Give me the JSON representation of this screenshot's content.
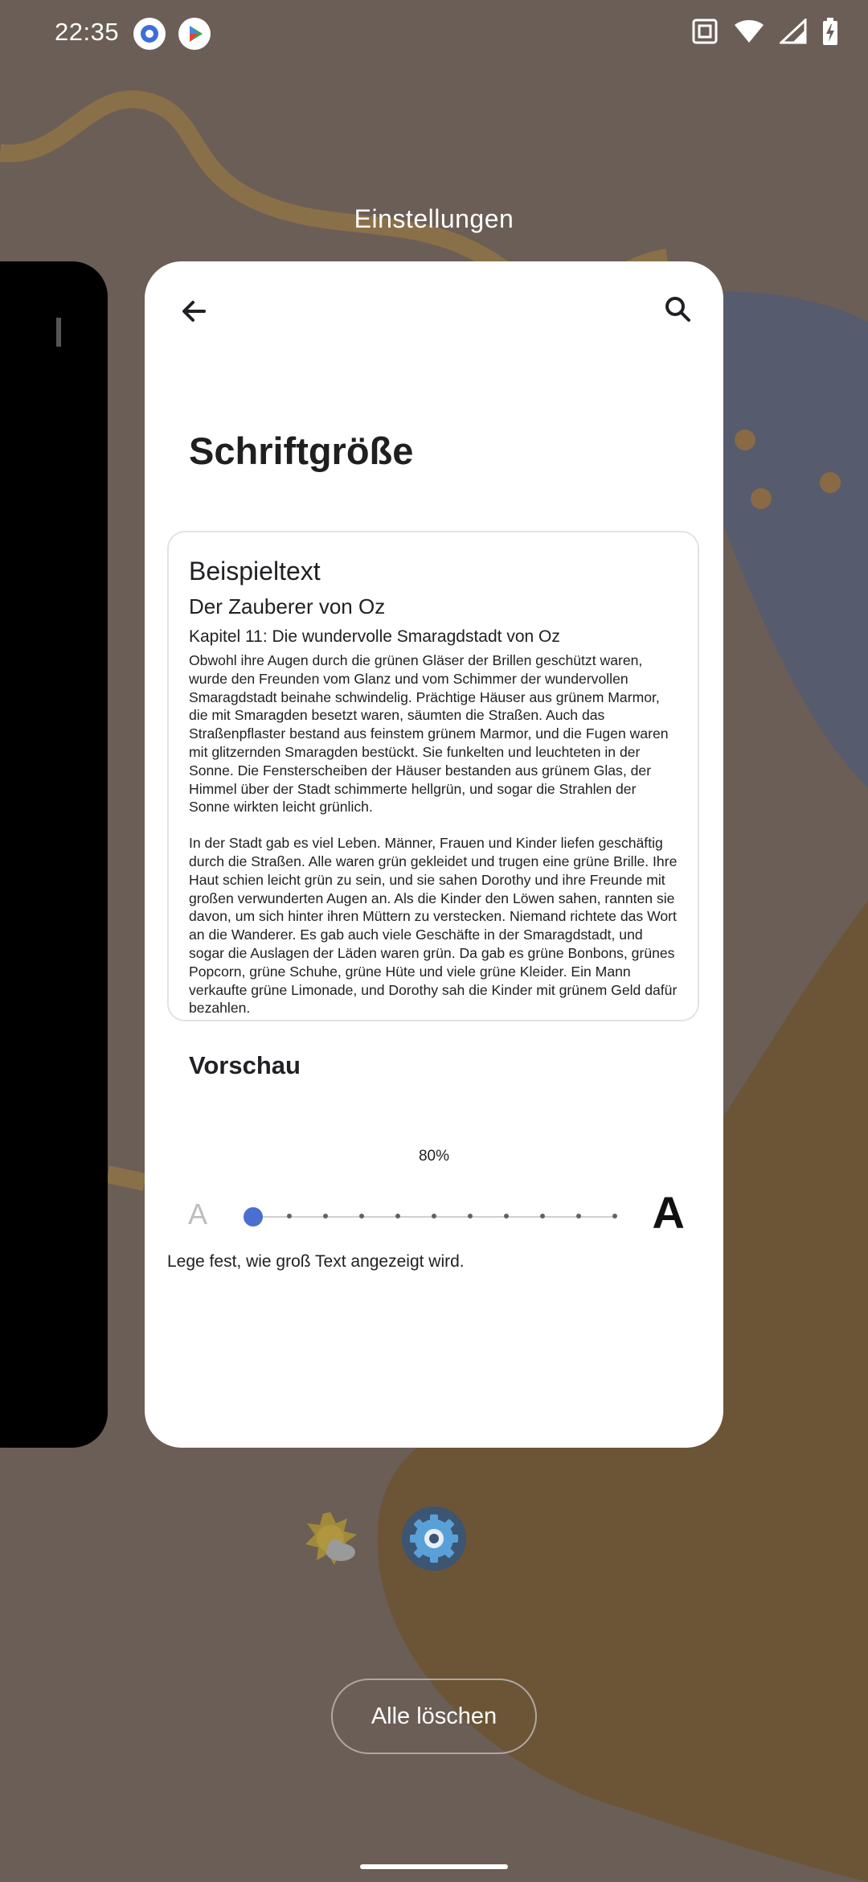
{
  "status_bar": {
    "time": "22:35",
    "left_icons": [
      "settings-icon",
      "play-store-icon"
    ],
    "right_icons": [
      "nfc-icon",
      "wifi-icon",
      "signal-icon",
      "battery-charging-icon"
    ]
  },
  "recents": {
    "title": "Einstellungen",
    "clear_all_label": "Alle löschen",
    "app_icons": [
      "weather-icon",
      "settings-gear-icon"
    ]
  },
  "settings_card": {
    "back_icon": "arrow-back-icon",
    "search_icon": "search-icon",
    "page_title": "Schriftgröße",
    "sample": {
      "heading": "Beispieltext",
      "book_title": "Der Zauberer von Oz",
      "chapter": "Kapitel 11: Die wundervolle Smaragdstadt von Oz",
      "paragraph1": "Obwohl ihre Augen durch die grünen Gläser der Brillen geschützt waren, wurde den Freunden vom Glanz und vom Schimmer der wundervollen Smaragdstadt beinahe schwindelig. Prächtige Häuser aus grünem Marmor, die mit Smaragden besetzt waren, säumten die Straßen. Auch das Straßenpflaster bestand aus feinstem grünem Marmor, und die Fugen waren mit glitzernden Smaragden bestückt. Sie funkelten und leuchteten in der Sonne. Die Fensterscheiben der Häuser bestanden aus grünem Glas, der Himmel über der Stadt schimmerte hellgrün, und sogar die Strahlen der Sonne wirkten leicht grünlich.",
      "paragraph2": "In der Stadt gab es viel Leben. Männer, Frauen und Kinder liefen geschäftig durch die Straßen. Alle waren grün gekleidet und trugen eine grüne Brille. Ihre Haut schien leicht grün zu sein, und sie sahen Dorothy und ihre Freunde mit großen verwunderten Augen an. Als die Kinder den Löwen sahen, rannten sie davon, um sich hinter ihren Müttern zu verstecken. Niemand richtete das Wort an die Wanderer. Es gab auch viele Geschäfte in der Smaragdstadt, und sogar die Auslagen der Läden waren grün. Da gab es grüne Bonbons, grünes Popcorn, grüne Schuhe, grüne Hüte und viele grüne Kleider. Ein Mann verkaufte grüne Limonade, und Dorothy sah die Kinder mit grünem Geld dafür bezahlen."
    },
    "preview_label": "Vorschau",
    "slider": {
      "value_label": "80%",
      "steps": 11,
      "selected_index": 0,
      "small_label": "A",
      "large_label": "A"
    },
    "caption": "Lege fest, wie groß Text angezeigt wird."
  },
  "colors": {
    "accent": "#4b6fd0",
    "background": "#6b5e56",
    "card": "#ffffff"
  }
}
